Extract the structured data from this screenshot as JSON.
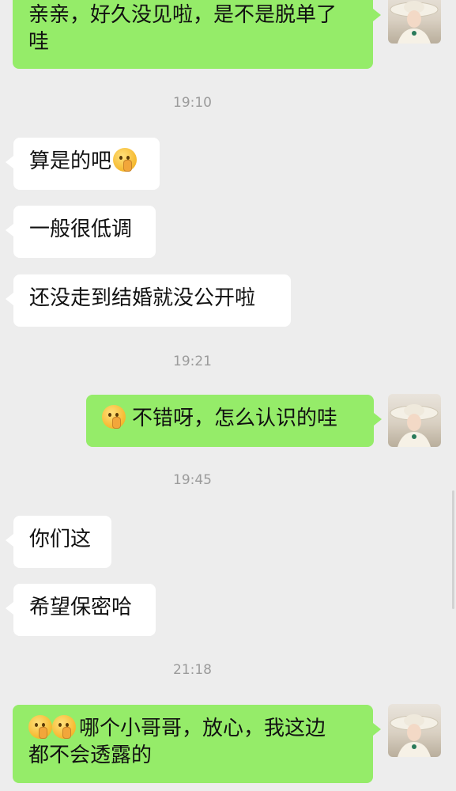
{
  "messages": [
    {
      "type": "out",
      "text_line1": "亲亲，好久没见啦，是不是脱单了",
      "text_line2": "哇"
    },
    {
      "type": "time",
      "text": "19:10"
    },
    {
      "type": "in",
      "text": "算是的吧",
      "emoji": "shush-face-icon"
    },
    {
      "type": "in",
      "text": "一般很低调"
    },
    {
      "type": "in",
      "text": "还没走到结婚就没公开啦"
    },
    {
      "type": "time",
      "text": "19:21"
    },
    {
      "type": "out",
      "text": "不错呀，怎么认识的哇",
      "emoji": "thinking-face-icon"
    },
    {
      "type": "time",
      "text": "19:45"
    },
    {
      "type": "in",
      "text": "你们这"
    },
    {
      "type": "in",
      "text": "希望保密哈"
    },
    {
      "type": "time",
      "text": "21:18"
    },
    {
      "type": "out",
      "text_line1": "哪个小哥哥，放心，我这边",
      "text_line2": "都不会透露的",
      "emoji": "thinking-face-icon x2"
    }
  ],
  "colors": {
    "background": "#ededed",
    "incoming_bubble": "#ffffff",
    "outgoing_bubble": "#95ec69",
    "timestamp": "#9b9b9b"
  }
}
